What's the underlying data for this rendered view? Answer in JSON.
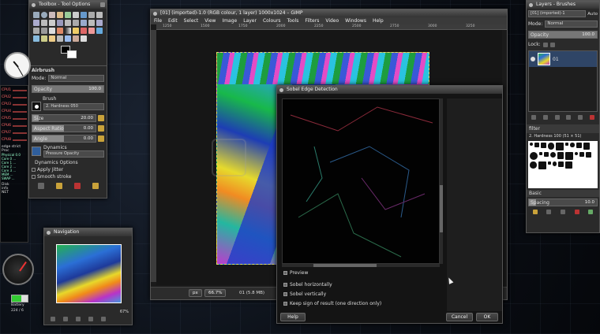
{
  "toolbox": {
    "title": "Toolbox - Tool Options",
    "tool_name": "Airbrush",
    "mode_label": "Mode:",
    "mode_value": "Normal",
    "opacity_label": "Opacity",
    "opacity_value": "100.0",
    "brush_label": "Brush",
    "brush_name": "2. Hardness 050",
    "size_label": "Size",
    "size_value": "20.00",
    "aspect_label": "Aspect Ratio",
    "aspect_value": "0.00",
    "angle_label": "Angle",
    "angle_value": "0.00",
    "dynamics_label": "Dynamics",
    "dynamics_value": "Pressure Opacity",
    "dynamics_options": "Dynamics Options",
    "apply_jitter": "Apply Jitter",
    "smooth_stroke": "Smooth stroke"
  },
  "monitor": {
    "cpu_labels": [
      "CPU1",
      "CPU2",
      "CPU3",
      "CPU4",
      "CPU5",
      "CPU6",
      "CPU7",
      "CPU8"
    ],
    "disk_label": "Disk",
    "info_label": "info",
    "proc_label": "Proc",
    "sys_lines": [
      "Physical 0.0",
      "Core 0 ...",
      "Core 1 ...",
      "Core 2 ...",
      "Core 3 ...",
      "MEM ...",
      "SWAP ..."
    ],
    "net_label": "NET",
    "edge_label": "edge strict",
    "battery_label": "Battery",
    "bottom_pct": "224 / 6"
  },
  "navigation": {
    "title": "Navigation",
    "zoom": "67%"
  },
  "image_window": {
    "title": "[01] (imported)-1.0 (RGB colour, 1 layer) 1000x1024 – GIMP",
    "menu": [
      "File",
      "Edit",
      "Select",
      "View",
      "Image",
      "Layer",
      "Colours",
      "Tools",
      "Filters",
      "Video",
      "Windows",
      "Help"
    ],
    "ruler_ticks": [
      "1250",
      "1500",
      "1750",
      "2000",
      "2250",
      "2500",
      "2750",
      "3000",
      "3250"
    ],
    "status_unit": "px",
    "status_zoom": "66.7%",
    "status_info": "01 (5.8 MB)"
  },
  "layers": {
    "title": "Layers - Brushes",
    "image_name": "[01] (imported)-1",
    "auto_label": "Auto",
    "mode_label": "Mode:",
    "mode_value": "Normal",
    "opacity_label": "Opacity",
    "opacity_value": "100.0",
    "lock_label": "Lock:",
    "layer_name": "01",
    "filter_label": "filter",
    "brush_name": "2. Hardness 100 (51 × 51)",
    "basic_label": "Basic",
    "spacing_label": "Spacing",
    "spacing_value": "10.0"
  },
  "dialog": {
    "title": "Sobel Edge Detection",
    "preview_label": "Preview",
    "options": [
      "Sobel horizontally",
      "Sobel vertically",
      "Keep sign of result (one direction only)"
    ],
    "help_label": "Help",
    "cancel_label": "Cancel",
    "ok_label": "OK"
  }
}
